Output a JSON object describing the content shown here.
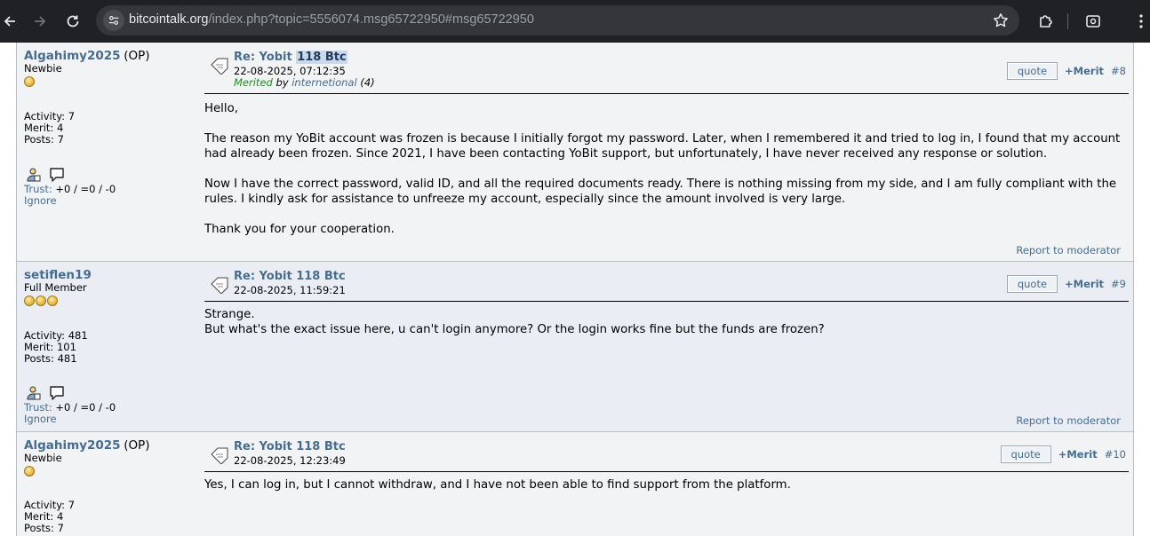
{
  "browser": {
    "url_host": "bitcointalk.org",
    "url_rest": "/index.php?topic=5556074.msg65722950#msg65722950"
  },
  "posts": [
    {
      "author": "Algahimy2025",
      "op_tag": "(OP)",
      "rank": "Newbie",
      "activity": "Activity: 7",
      "merit": "Merit: 4",
      "posts": "Posts: 7",
      "trust_label": "Trust:",
      "trust_value": "+0 / =0 / -0",
      "ignore": "Ignore",
      "subject_prefix": "Re: Yobit ",
      "subject_highlight": "118 Btc",
      "date": "22-08-2025, 07:12:35",
      "merited_word": "Merited",
      "merited_by": " by ",
      "merited_user": "internetional",
      "merited_count": " (4)",
      "quote": "quote",
      "merit_link": "+Merit",
      "number": "#8",
      "body": [
        "Hello,",
        "The reason my YoBit account was frozen is because I initially forgot my password. Later, when I remembered it and tried to log in, I found that my account had already been frozen. Since 2021, I have been contacting YoBit support, but unfortunately, I have never received any response or solution.",
        "Now I have the correct password, valid ID, and all the required documents ready. There is nothing missing from my side, and I am fully compliant with the rules. I kindly ask for assistance to unfreeze my account, especially since the amount involved is very large.",
        "Thank you for your cooperation."
      ],
      "report": "Report to moderator"
    },
    {
      "author": "setiflen19",
      "rank": "Full Member",
      "activity": "Activity: 481",
      "merit": "Merit: 101",
      "posts": "Posts: 481",
      "trust_label": "Trust:",
      "trust_value": "+0 / =0 / -0",
      "ignore": "Ignore",
      "subject": "Re: Yobit 118 Btc",
      "date": "22-08-2025, 11:59:21",
      "quote": "quote",
      "merit_link": "+Merit",
      "number": "#9",
      "body": [
        "Strange.",
        "But what's the exact issue here, u can't login anymore? Or the login works fine but the funds are frozen?"
      ],
      "report": "Report to moderator"
    },
    {
      "author": "Algahimy2025",
      "op_tag": "(OP)",
      "rank": "Newbie",
      "activity": "Activity: 7",
      "merit": "Merit: 4",
      "posts": "Posts: 7",
      "subject": "Re: Yobit 118 Btc",
      "date": "22-08-2025, 12:23:49",
      "quote": "quote",
      "merit_link": "+Merit",
      "number": "#10",
      "body": [
        "Yes, I can log in, but I cannot withdraw, and I have not been able to find support from the platform."
      ]
    }
  ]
}
